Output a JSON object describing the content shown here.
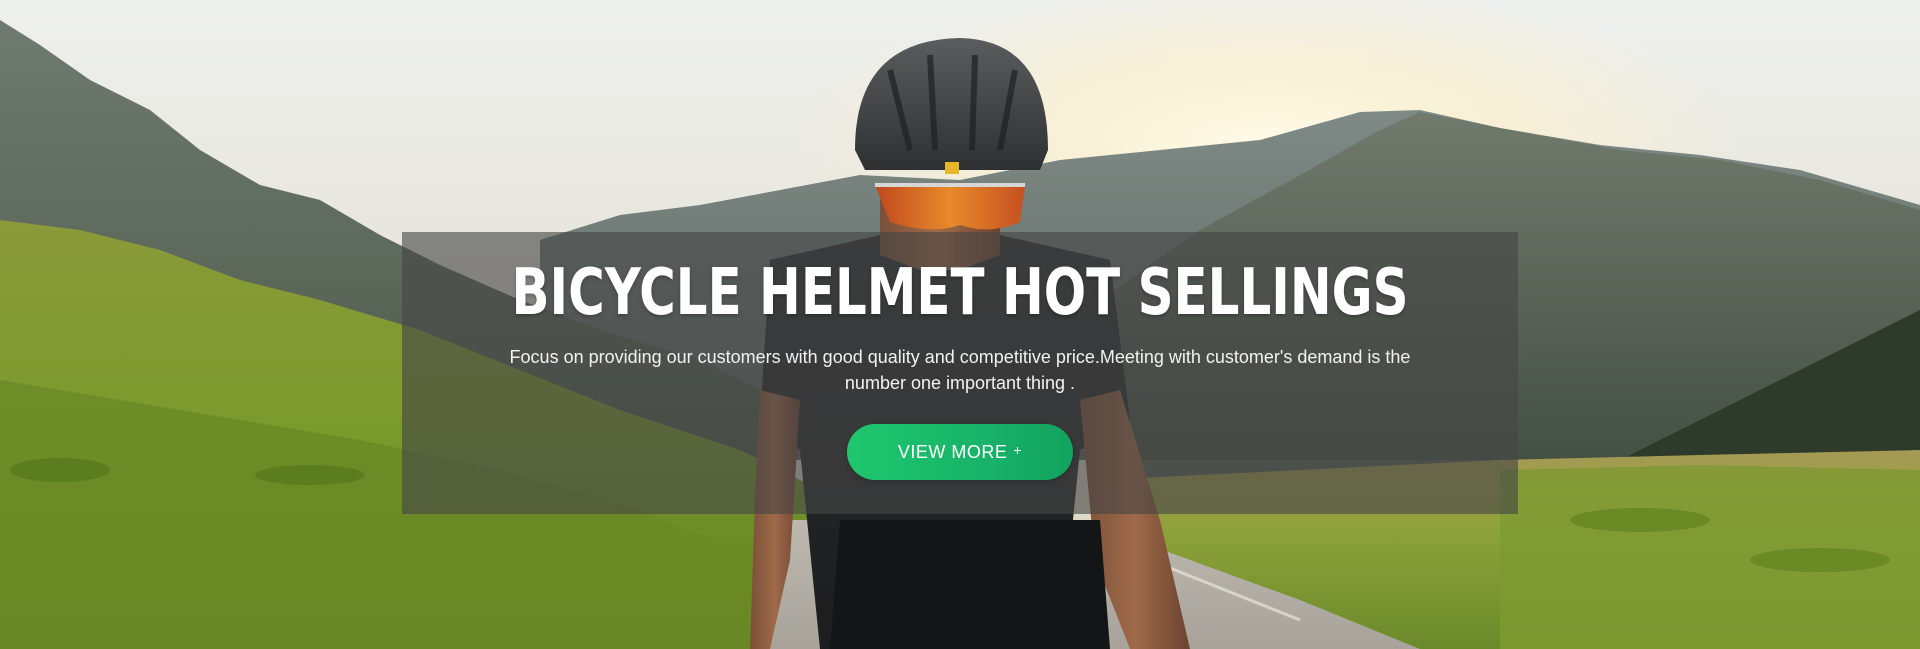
{
  "hero": {
    "headline": "BICYCLE HELMET HOT SELLINGS",
    "subtext": "Focus on providing our customers with good quality and competitive price.Meeting with customer's demand is the number one important thing .",
    "cta_label": "VIEW MORE",
    "cta_icon": "+",
    "cta_icon_name": "plus-icon",
    "background_image": "cyclist-riding-mountain-road-photo",
    "colors": {
      "overlay": "#464646",
      "cta_start": "#1ec76c",
      "cta_end": "#12a25f",
      "text": "#ffffff"
    }
  }
}
